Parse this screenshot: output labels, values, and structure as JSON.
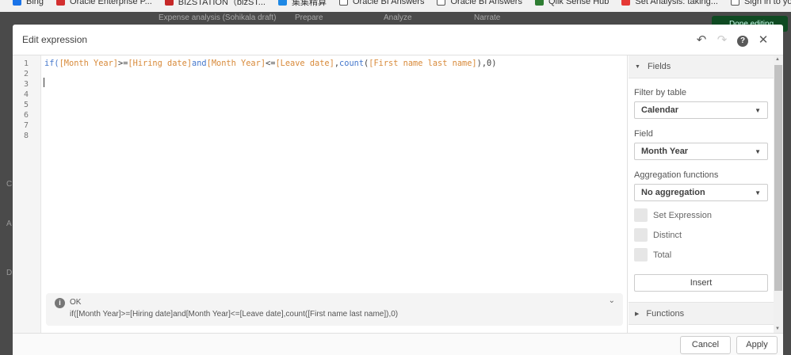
{
  "bookmarks": [
    {
      "label": "Bing",
      "color": "#1a73e8"
    },
    {
      "label": "Oracle Enterprise P...",
      "color": "#d32f2f"
    },
    {
      "label": "BIZSTATION（bizST...",
      "color": "#c62828"
    },
    {
      "label": "集集精算",
      "color": "#1e88e5"
    },
    {
      "label": "Oracle BI Answers",
      "color": "#ffffff"
    },
    {
      "label": "Oracle BI Answers",
      "color": "#ffffff"
    },
    {
      "label": "Qlik Sense Hub",
      "color": "#2e7d32"
    },
    {
      "label": "Set Analysis: taking...",
      "color": "#e53935"
    },
    {
      "label": "Sign in to your Qlik...",
      "color": "#ffffff"
    }
  ],
  "app": {
    "title": "Expense analysis (Sohikala draft)",
    "tabs": [
      "Prepare",
      "Analyze",
      "Narrate"
    ],
    "done_label": "Done editing",
    "side_letters": [
      "C",
      "A",
      "D"
    ],
    "accent": "#0f4a22"
  },
  "dialog": {
    "title": "Edit expression",
    "icons": [
      "undo-icon",
      "redo-icon",
      "help-icon",
      "close-icon"
    ],
    "line_numbers": [
      "1",
      "2",
      "3",
      "4",
      "5",
      "6",
      "7",
      "8"
    ],
    "code": {
      "t1": "if(",
      "t2": "[Month Year]",
      "t3": ">=",
      "t4": "[Hiring date]",
      "t5": "and",
      "t6": "[Month Year]",
      "t7": "<=",
      "t8": "[Leave date]",
      "t9": ",",
      "t10": "count",
      "t11": "(",
      "t12": "[First name last name]",
      "t13": "),0)"
    },
    "status": {
      "state": "OK",
      "expression": "if([Month Year]>=[Hiring date]and[Month Year]<=[Leave date],count([First name last name]),0)"
    },
    "panel": {
      "fields_header": "Fields",
      "filter_label": "Filter by table",
      "filter_value": "Calendar",
      "field_label": "Field",
      "field_value": "Month Year",
      "agg_label": "Aggregation functions",
      "agg_value": "No aggregation",
      "checkboxes": [
        {
          "label": "Set Expression",
          "checked": false
        },
        {
          "label": "Distinct",
          "checked": false
        },
        {
          "label": "Total",
          "checked": false
        }
      ],
      "insert_label": "Insert",
      "functions_header": "Functions"
    },
    "cancel_label": "Cancel",
    "apply_label": "Apply"
  }
}
